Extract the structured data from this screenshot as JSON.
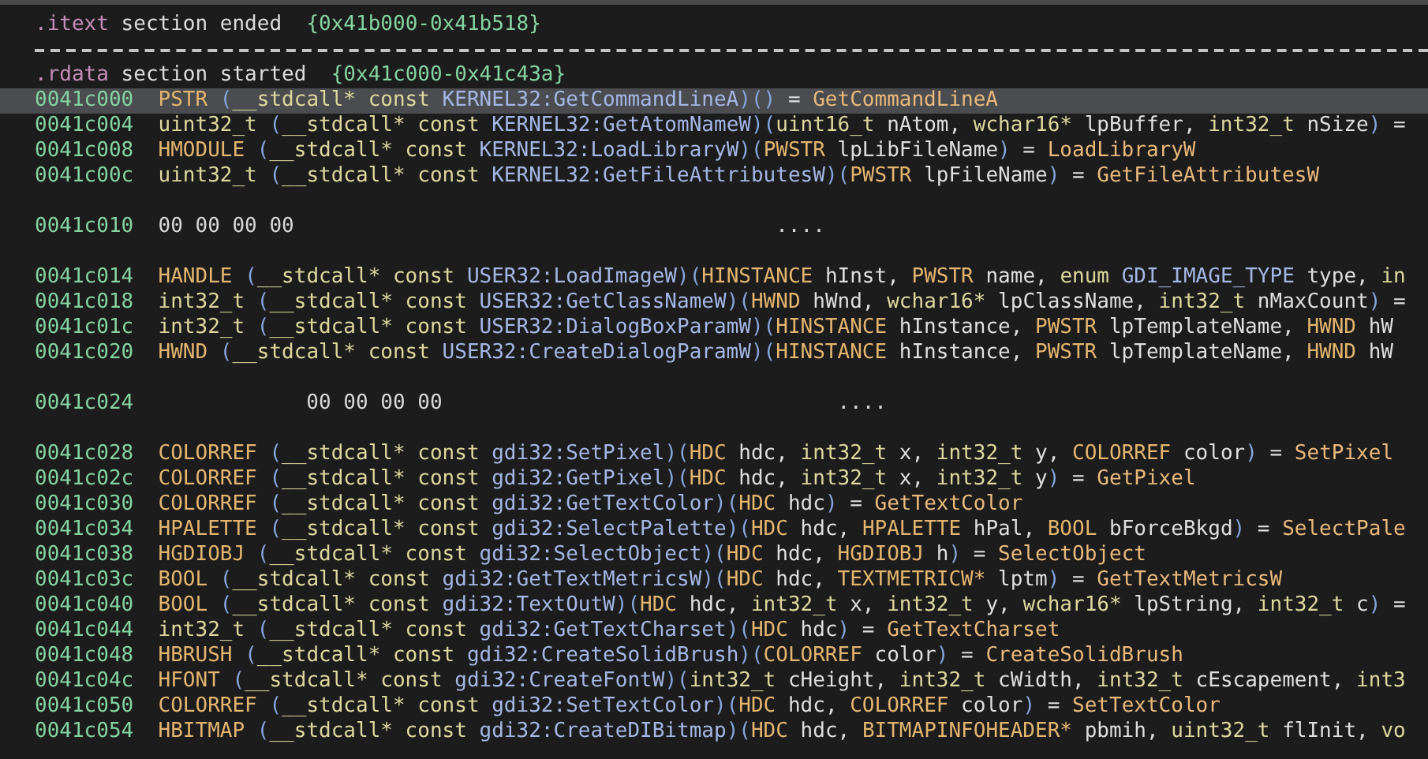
{
  "rows": [
    {
      "kind": "section",
      "selected": false,
      "gap_before": false,
      "name": ".itext",
      "text": "section ended",
      "range": "{0x41b000-0x41b518}"
    },
    {
      "kind": "separator"
    },
    {
      "kind": "section",
      "selected": false,
      "gap_before": false,
      "name": ".rdata",
      "text": "section started",
      "range": "{0x41c000-0x41c43a}"
    },
    {
      "kind": "function",
      "selected": true,
      "gap_before": false,
      "address": "0041c000",
      "segments": [
        {
          "kind": "type",
          "text": "PSTR "
        },
        {
          "kind": "paren",
          "text": "("
        },
        {
          "kind": "prim",
          "text": "__stdcall* const "
        },
        {
          "kind": "sym",
          "text": "KERNEL32:GetCommandLineA"
        },
        {
          "kind": "paren",
          "text": ")()"
        },
        {
          "kind": "plain",
          "text": " = "
        },
        {
          "kind": "fn",
          "text": "GetCommandLineA"
        }
      ]
    },
    {
      "kind": "function",
      "selected": false,
      "gap_before": false,
      "address": "0041c004",
      "segments": [
        {
          "kind": "prim",
          "text": "uint32_t "
        },
        {
          "kind": "paren",
          "text": "("
        },
        {
          "kind": "prim",
          "text": "__stdcall* const "
        },
        {
          "kind": "sym",
          "text": "KERNEL32:GetAtomNameW"
        },
        {
          "kind": "paren",
          "text": ")("
        },
        {
          "kind": "prim",
          "text": "uint16_t"
        },
        {
          "kind": "plain",
          "text": " nAtom, "
        },
        {
          "kind": "prim",
          "text": "wchar16*"
        },
        {
          "kind": "plain",
          "text": " lpBuffer, "
        },
        {
          "kind": "prim",
          "text": "int32_t"
        },
        {
          "kind": "plain",
          "text": " nSize"
        },
        {
          "kind": "paren",
          "text": ")"
        },
        {
          "kind": "plain",
          "text": " ="
        }
      ]
    },
    {
      "kind": "function",
      "selected": false,
      "gap_before": false,
      "address": "0041c008",
      "segments": [
        {
          "kind": "type",
          "text": "HMODULE "
        },
        {
          "kind": "paren",
          "text": "("
        },
        {
          "kind": "prim",
          "text": "__stdcall* const "
        },
        {
          "kind": "sym",
          "text": "KERNEL32:LoadLibraryW"
        },
        {
          "kind": "paren",
          "text": ")("
        },
        {
          "kind": "type",
          "text": "PWSTR"
        },
        {
          "kind": "plain",
          "text": " lpLibFileName"
        },
        {
          "kind": "paren",
          "text": ")"
        },
        {
          "kind": "plain",
          "text": " = "
        },
        {
          "kind": "fn",
          "text": "LoadLibraryW"
        }
      ]
    },
    {
      "kind": "function",
      "selected": false,
      "gap_before": false,
      "address": "0041c00c",
      "segments": [
        {
          "kind": "prim",
          "text": "uint32_t "
        },
        {
          "kind": "paren",
          "text": "("
        },
        {
          "kind": "prim",
          "text": "__stdcall* const "
        },
        {
          "kind": "sym",
          "text": "KERNEL32:GetFileAttributesW"
        },
        {
          "kind": "paren",
          "text": ")("
        },
        {
          "kind": "type",
          "text": "PWSTR"
        },
        {
          "kind": "plain",
          "text": " lpFileName"
        },
        {
          "kind": "paren",
          "text": ")"
        },
        {
          "kind": "plain",
          "text": " = "
        },
        {
          "kind": "fn",
          "text": "GetFileAttributesW"
        }
      ]
    },
    {
      "kind": "data",
      "selected": false,
      "gap_before": true,
      "indented": false,
      "address": "0041c010",
      "bytes": "00 00 00 00",
      "ascii": "...."
    },
    {
      "kind": "function",
      "selected": false,
      "gap_before": true,
      "address": "0041c014",
      "segments": [
        {
          "kind": "type",
          "text": "HANDLE "
        },
        {
          "kind": "paren",
          "text": "("
        },
        {
          "kind": "prim",
          "text": "__stdcall* const "
        },
        {
          "kind": "sym",
          "text": "USER32:LoadImageW"
        },
        {
          "kind": "paren",
          "text": ")("
        },
        {
          "kind": "type",
          "text": "HINSTANCE"
        },
        {
          "kind": "plain",
          "text": " hInst, "
        },
        {
          "kind": "type",
          "text": "PWSTR"
        },
        {
          "kind": "plain",
          "text": " name, "
        },
        {
          "kind": "prim",
          "text": "enum "
        },
        {
          "kind": "sym",
          "text": "GDI_IMAGE_TYPE"
        },
        {
          "kind": "plain",
          "text": " type, "
        },
        {
          "kind": "prim",
          "text": "in"
        }
      ]
    },
    {
      "kind": "function",
      "selected": false,
      "gap_before": false,
      "address": "0041c018",
      "segments": [
        {
          "kind": "prim",
          "text": "int32_t "
        },
        {
          "kind": "paren",
          "text": "("
        },
        {
          "kind": "prim",
          "text": "__stdcall* const "
        },
        {
          "kind": "sym",
          "text": "USER32:GetClassNameW"
        },
        {
          "kind": "paren",
          "text": ")("
        },
        {
          "kind": "type",
          "text": "HWND"
        },
        {
          "kind": "plain",
          "text": " hWnd, "
        },
        {
          "kind": "prim",
          "text": "wchar16*"
        },
        {
          "kind": "plain",
          "text": " lpClassName, "
        },
        {
          "kind": "prim",
          "text": "int32_t"
        },
        {
          "kind": "plain",
          "text": " nMaxCount"
        },
        {
          "kind": "paren",
          "text": ")"
        },
        {
          "kind": "plain",
          "text": " ="
        }
      ]
    },
    {
      "kind": "function",
      "selected": false,
      "gap_before": false,
      "address": "0041c01c",
      "segments": [
        {
          "kind": "prim",
          "text": "int32_t "
        },
        {
          "kind": "paren",
          "text": "("
        },
        {
          "kind": "prim",
          "text": "__stdcall* const "
        },
        {
          "kind": "sym",
          "text": "USER32:DialogBoxParamW"
        },
        {
          "kind": "paren",
          "text": ")("
        },
        {
          "kind": "type",
          "text": "HINSTANCE"
        },
        {
          "kind": "plain",
          "text": " hInstance, "
        },
        {
          "kind": "type",
          "text": "PWSTR"
        },
        {
          "kind": "plain",
          "text": " lpTemplateName, "
        },
        {
          "kind": "type",
          "text": "HWND"
        },
        {
          "kind": "plain",
          "text": " hW"
        }
      ]
    },
    {
      "kind": "function",
      "selected": false,
      "gap_before": false,
      "address": "0041c020",
      "segments": [
        {
          "kind": "type",
          "text": "HWND "
        },
        {
          "kind": "paren",
          "text": "("
        },
        {
          "kind": "prim",
          "text": "__stdcall* const "
        },
        {
          "kind": "sym",
          "text": "USER32:CreateDialogParamW"
        },
        {
          "kind": "paren",
          "text": ")("
        },
        {
          "kind": "type",
          "text": "HINSTANCE"
        },
        {
          "kind": "plain",
          "text": " hInstance, "
        },
        {
          "kind": "type",
          "text": "PWSTR"
        },
        {
          "kind": "plain",
          "text": " lpTemplateName, "
        },
        {
          "kind": "type",
          "text": "HWND"
        },
        {
          "kind": "plain",
          "text": " hW"
        }
      ]
    },
    {
      "kind": "data",
      "selected": false,
      "gap_before": true,
      "indented": true,
      "address": "0041c024",
      "bytes": "00 00 00 00",
      "ascii": "...."
    },
    {
      "kind": "function",
      "selected": false,
      "gap_before": true,
      "address": "0041c028",
      "segments": [
        {
          "kind": "type",
          "text": "COLORREF "
        },
        {
          "kind": "paren",
          "text": "("
        },
        {
          "kind": "prim",
          "text": "__stdcall* const "
        },
        {
          "kind": "sym",
          "text": "gdi32:SetPixel"
        },
        {
          "kind": "paren",
          "text": ")("
        },
        {
          "kind": "type",
          "text": "HDC"
        },
        {
          "kind": "plain",
          "text": " hdc, "
        },
        {
          "kind": "prim",
          "text": "int32_t"
        },
        {
          "kind": "plain",
          "text": " x, "
        },
        {
          "kind": "prim",
          "text": "int32_t"
        },
        {
          "kind": "plain",
          "text": " y, "
        },
        {
          "kind": "type",
          "text": "COLORREF"
        },
        {
          "kind": "plain",
          "text": " color"
        },
        {
          "kind": "paren",
          "text": ")"
        },
        {
          "kind": "plain",
          "text": " = "
        },
        {
          "kind": "fn",
          "text": "SetPixel"
        }
      ]
    },
    {
      "kind": "function",
      "selected": false,
      "gap_before": false,
      "address": "0041c02c",
      "segments": [
        {
          "kind": "type",
          "text": "COLORREF "
        },
        {
          "kind": "paren",
          "text": "("
        },
        {
          "kind": "prim",
          "text": "__stdcall* const "
        },
        {
          "kind": "sym",
          "text": "gdi32:GetPixel"
        },
        {
          "kind": "paren",
          "text": ")("
        },
        {
          "kind": "type",
          "text": "HDC"
        },
        {
          "kind": "plain",
          "text": " hdc, "
        },
        {
          "kind": "prim",
          "text": "int32_t"
        },
        {
          "kind": "plain",
          "text": " x, "
        },
        {
          "kind": "prim",
          "text": "int32_t"
        },
        {
          "kind": "plain",
          "text": " y"
        },
        {
          "kind": "paren",
          "text": ")"
        },
        {
          "kind": "plain",
          "text": " = "
        },
        {
          "kind": "fn",
          "text": "GetPixel"
        }
      ]
    },
    {
      "kind": "function",
      "selected": false,
      "gap_before": false,
      "address": "0041c030",
      "segments": [
        {
          "kind": "type",
          "text": "COLORREF "
        },
        {
          "kind": "paren",
          "text": "("
        },
        {
          "kind": "prim",
          "text": "__stdcall* const "
        },
        {
          "kind": "sym",
          "text": "gdi32:GetTextColor"
        },
        {
          "kind": "paren",
          "text": ")("
        },
        {
          "kind": "type",
          "text": "HDC"
        },
        {
          "kind": "plain",
          "text": " hdc"
        },
        {
          "kind": "paren",
          "text": ")"
        },
        {
          "kind": "plain",
          "text": " = "
        },
        {
          "kind": "fn",
          "text": "GetTextColor"
        }
      ]
    },
    {
      "kind": "function",
      "selected": false,
      "gap_before": false,
      "address": "0041c034",
      "segments": [
        {
          "kind": "type",
          "text": "HPALETTE "
        },
        {
          "kind": "paren",
          "text": "("
        },
        {
          "kind": "prim",
          "text": "__stdcall* const "
        },
        {
          "kind": "sym",
          "text": "gdi32:SelectPalette"
        },
        {
          "kind": "paren",
          "text": ")("
        },
        {
          "kind": "type",
          "text": "HDC"
        },
        {
          "kind": "plain",
          "text": " hdc, "
        },
        {
          "kind": "type",
          "text": "HPALETTE"
        },
        {
          "kind": "plain",
          "text": " hPal, "
        },
        {
          "kind": "type",
          "text": "BOOL"
        },
        {
          "kind": "plain",
          "text": " bForceBkgd"
        },
        {
          "kind": "paren",
          "text": ")"
        },
        {
          "kind": "plain",
          "text": " = "
        },
        {
          "kind": "fn",
          "text": "SelectPale"
        }
      ]
    },
    {
      "kind": "function",
      "selected": false,
      "gap_before": false,
      "address": "0041c038",
      "segments": [
        {
          "kind": "type",
          "text": "HGDIOBJ "
        },
        {
          "kind": "paren",
          "text": "("
        },
        {
          "kind": "prim",
          "text": "__stdcall* const "
        },
        {
          "kind": "sym",
          "text": "gdi32:SelectObject"
        },
        {
          "kind": "paren",
          "text": ")("
        },
        {
          "kind": "type",
          "text": "HDC"
        },
        {
          "kind": "plain",
          "text": " hdc, "
        },
        {
          "kind": "type",
          "text": "HGDIOBJ"
        },
        {
          "kind": "plain",
          "text": " h"
        },
        {
          "kind": "paren",
          "text": ")"
        },
        {
          "kind": "plain",
          "text": " = "
        },
        {
          "kind": "fn",
          "text": "SelectObject"
        }
      ]
    },
    {
      "kind": "function",
      "selected": false,
      "gap_before": false,
      "address": "0041c03c",
      "segments": [
        {
          "kind": "type",
          "text": "BOOL "
        },
        {
          "kind": "paren",
          "text": "("
        },
        {
          "kind": "prim",
          "text": "__stdcall* const "
        },
        {
          "kind": "sym",
          "text": "gdi32:GetTextMetricsW"
        },
        {
          "kind": "paren",
          "text": ")("
        },
        {
          "kind": "type",
          "text": "HDC"
        },
        {
          "kind": "plain",
          "text": " hdc, "
        },
        {
          "kind": "type",
          "text": "TEXTMETRICW*"
        },
        {
          "kind": "plain",
          "text": " lptm"
        },
        {
          "kind": "paren",
          "text": ")"
        },
        {
          "kind": "plain",
          "text": " = "
        },
        {
          "kind": "fn",
          "text": "GetTextMetricsW"
        }
      ]
    },
    {
      "kind": "function",
      "selected": false,
      "gap_before": false,
      "address": "0041c040",
      "segments": [
        {
          "kind": "type",
          "text": "BOOL "
        },
        {
          "kind": "paren",
          "text": "("
        },
        {
          "kind": "prim",
          "text": "__stdcall* const "
        },
        {
          "kind": "sym",
          "text": "gdi32:TextOutW"
        },
        {
          "kind": "paren",
          "text": ")("
        },
        {
          "kind": "type",
          "text": "HDC"
        },
        {
          "kind": "plain",
          "text": " hdc, "
        },
        {
          "kind": "prim",
          "text": "int32_t"
        },
        {
          "kind": "plain",
          "text": " x, "
        },
        {
          "kind": "prim",
          "text": "int32_t"
        },
        {
          "kind": "plain",
          "text": " y, "
        },
        {
          "kind": "prim",
          "text": "wchar16*"
        },
        {
          "kind": "plain",
          "text": " lpString, "
        },
        {
          "kind": "prim",
          "text": "int32_t"
        },
        {
          "kind": "plain",
          "text": " c"
        },
        {
          "kind": "paren",
          "text": ")"
        },
        {
          "kind": "plain",
          "text": " ="
        }
      ]
    },
    {
      "kind": "function",
      "selected": false,
      "gap_before": false,
      "address": "0041c044",
      "segments": [
        {
          "kind": "prim",
          "text": "int32_t "
        },
        {
          "kind": "paren",
          "text": "("
        },
        {
          "kind": "prim",
          "text": "__stdcall* const "
        },
        {
          "kind": "sym",
          "text": "gdi32:GetTextCharset"
        },
        {
          "kind": "paren",
          "text": ")("
        },
        {
          "kind": "type",
          "text": "HDC"
        },
        {
          "kind": "plain",
          "text": " hdc"
        },
        {
          "kind": "paren",
          "text": ")"
        },
        {
          "kind": "plain",
          "text": " = "
        },
        {
          "kind": "fn",
          "text": "GetTextCharset"
        }
      ]
    },
    {
      "kind": "function",
      "selected": false,
      "gap_before": false,
      "address": "0041c048",
      "segments": [
        {
          "kind": "type",
          "text": "HBRUSH "
        },
        {
          "kind": "paren",
          "text": "("
        },
        {
          "kind": "prim",
          "text": "__stdcall* const "
        },
        {
          "kind": "sym",
          "text": "gdi32:CreateSolidBrush"
        },
        {
          "kind": "paren",
          "text": ")("
        },
        {
          "kind": "type",
          "text": "COLORREF"
        },
        {
          "kind": "plain",
          "text": " color"
        },
        {
          "kind": "paren",
          "text": ")"
        },
        {
          "kind": "plain",
          "text": " = "
        },
        {
          "kind": "fn",
          "text": "CreateSolidBrush"
        }
      ]
    },
    {
      "kind": "function",
      "selected": false,
      "gap_before": false,
      "address": "0041c04c",
      "segments": [
        {
          "kind": "type",
          "text": "HFONT "
        },
        {
          "kind": "paren",
          "text": "("
        },
        {
          "kind": "prim",
          "text": "__stdcall* const "
        },
        {
          "kind": "sym",
          "text": "gdi32:CreateFontW"
        },
        {
          "kind": "paren",
          "text": ")("
        },
        {
          "kind": "prim",
          "text": "int32_t"
        },
        {
          "kind": "plain",
          "text": " cHeight, "
        },
        {
          "kind": "prim",
          "text": "int32_t"
        },
        {
          "kind": "plain",
          "text": " cWidth, "
        },
        {
          "kind": "prim",
          "text": "int32_t"
        },
        {
          "kind": "plain",
          "text": " cEscapement, "
        },
        {
          "kind": "prim",
          "text": "int3"
        }
      ]
    },
    {
      "kind": "function",
      "selected": false,
      "gap_before": false,
      "address": "0041c050",
      "segments": [
        {
          "kind": "type",
          "text": "COLORREF "
        },
        {
          "kind": "paren",
          "text": "("
        },
        {
          "kind": "prim",
          "text": "__stdcall* const "
        },
        {
          "kind": "sym",
          "text": "gdi32:SetTextColor"
        },
        {
          "kind": "paren",
          "text": ")("
        },
        {
          "kind": "type",
          "text": "HDC"
        },
        {
          "kind": "plain",
          "text": " hdc, "
        },
        {
          "kind": "type",
          "text": "COLORREF"
        },
        {
          "kind": "plain",
          "text": " color"
        },
        {
          "kind": "paren",
          "text": ")"
        },
        {
          "kind": "plain",
          "text": " = "
        },
        {
          "kind": "fn",
          "text": "SetTextColor"
        }
      ]
    },
    {
      "kind": "function",
      "selected": false,
      "gap_before": false,
      "address": "0041c054",
      "segments": [
        {
          "kind": "type",
          "text": "HBITMAP "
        },
        {
          "kind": "paren",
          "text": "("
        },
        {
          "kind": "prim",
          "text": "__stdcall* const "
        },
        {
          "kind": "sym",
          "text": "gdi32:CreateDIBitmap"
        },
        {
          "kind": "paren",
          "text": ")("
        },
        {
          "kind": "type",
          "text": "HDC"
        },
        {
          "kind": "plain",
          "text": " hdc, "
        },
        {
          "kind": "type",
          "text": "BITMAPINFOHEADER*"
        },
        {
          "kind": "plain",
          "text": " pbmih, "
        },
        {
          "kind": "prim",
          "text": "uint32_t"
        },
        {
          "kind": "plain",
          "text": " flInit, "
        },
        {
          "kind": "prim",
          "text": "vo"
        }
      ]
    }
  ]
}
